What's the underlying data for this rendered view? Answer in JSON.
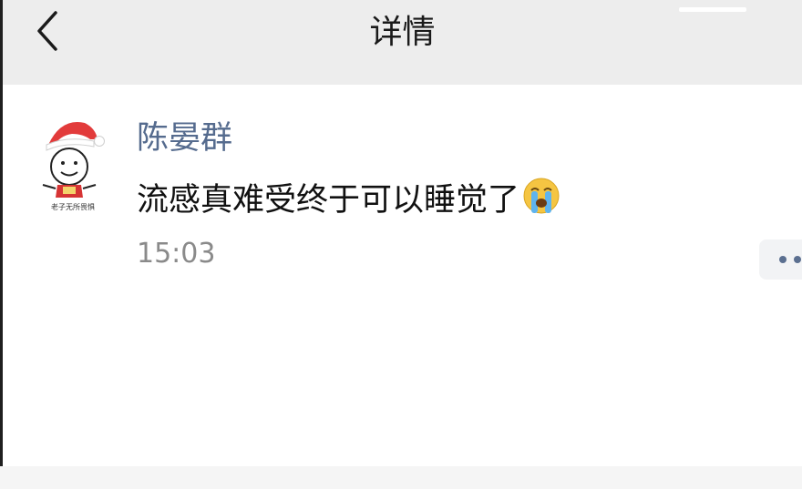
{
  "header": {
    "title": "详情",
    "back_icon": "chevron-left-icon"
  },
  "post": {
    "author": "陈晏群",
    "avatar_caption": "老子无所畏惧",
    "content": "流感真难受终于可以睡觉了",
    "emoji": "crying-face-emoji",
    "time": "15:03"
  },
  "more_button": {
    "icon": "more-dots-icon"
  },
  "colors": {
    "header_bg": "#ededed",
    "author": "#556b8e",
    "time": "#8a8a8a",
    "more_dots": "#5b6f90"
  }
}
